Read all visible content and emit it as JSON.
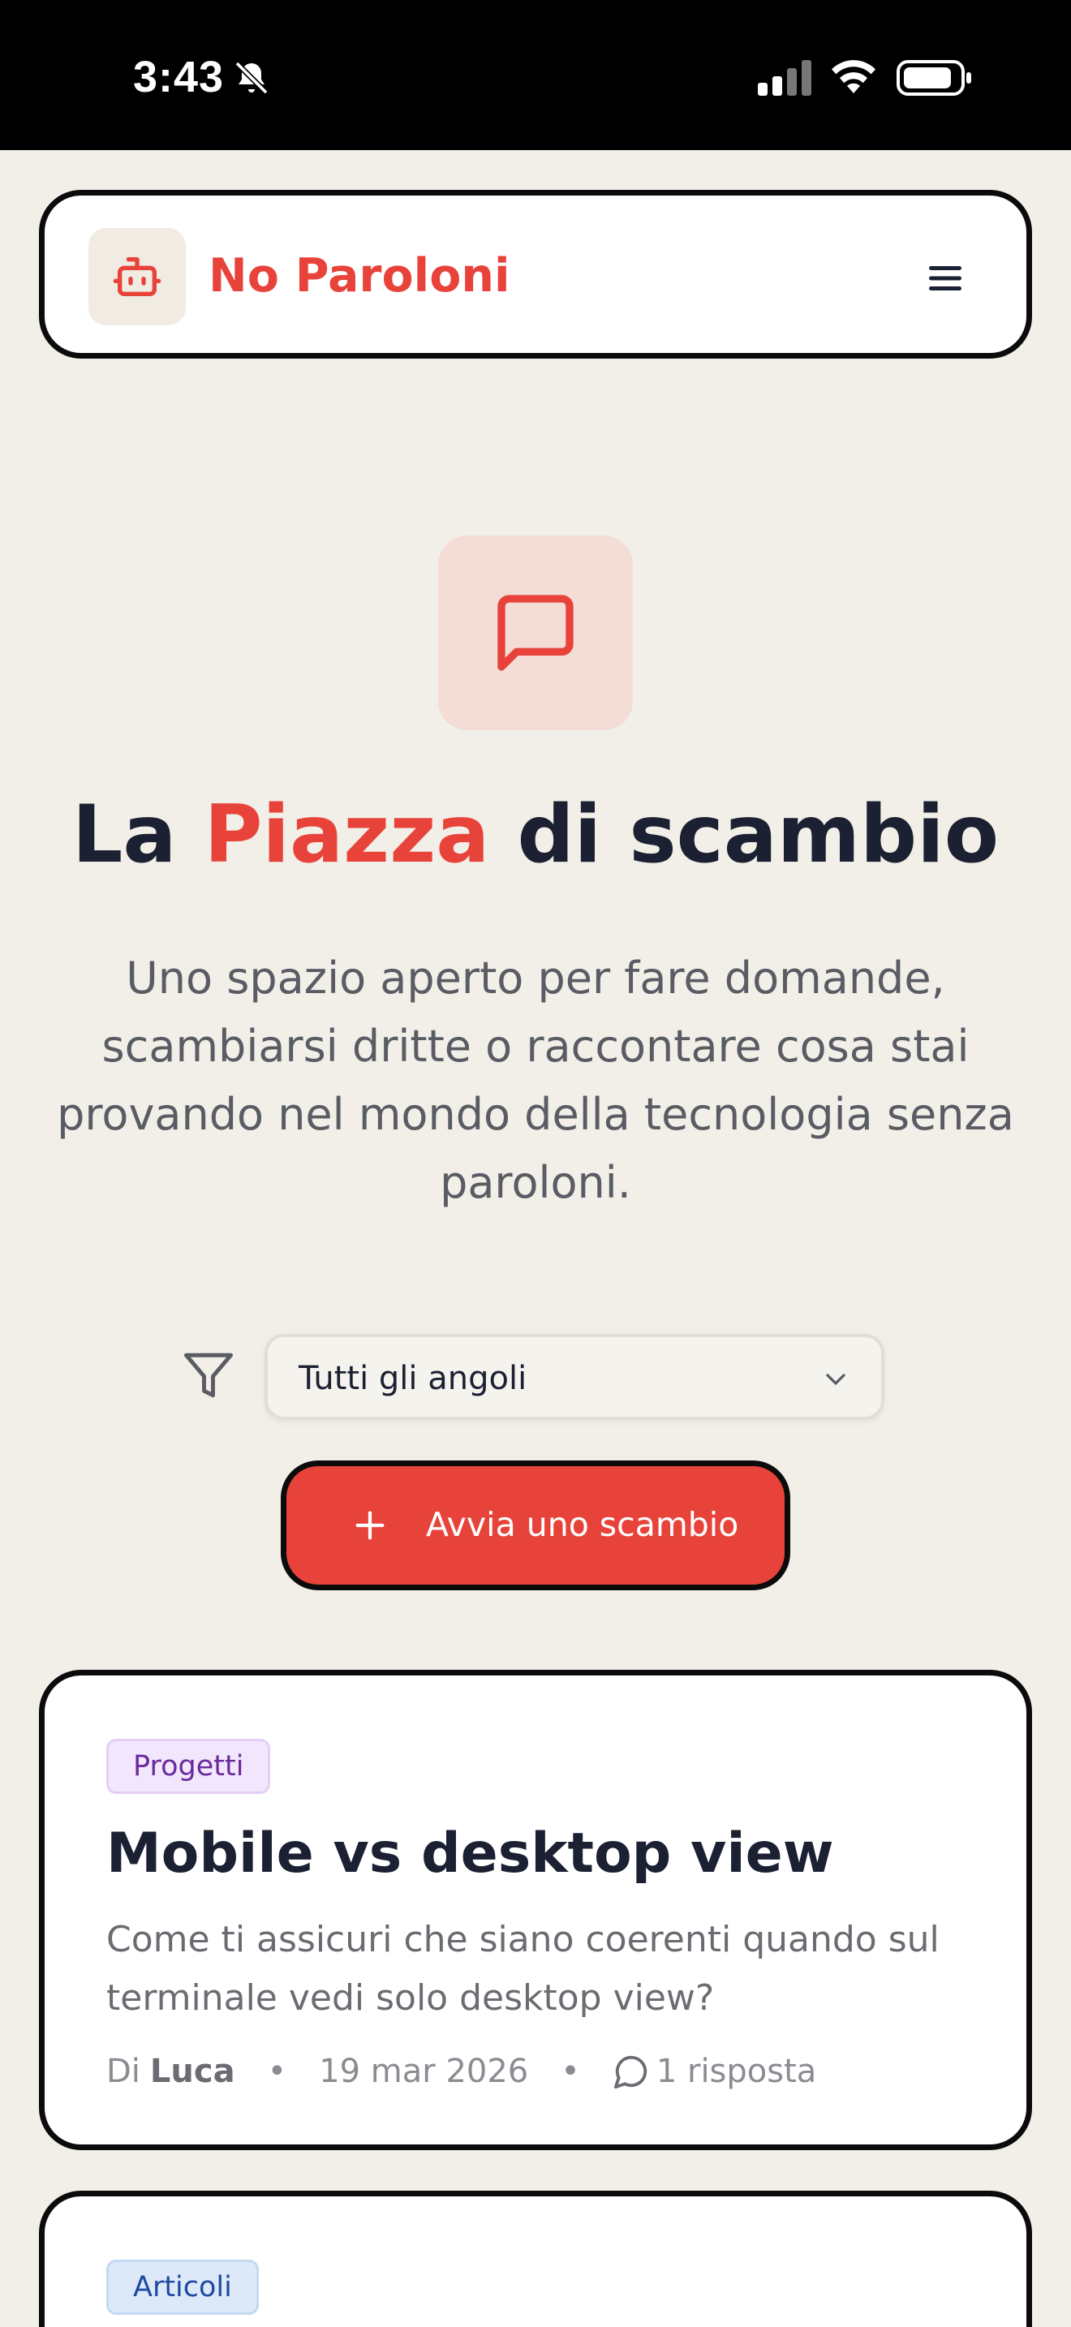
{
  "status_bar": {
    "time": "3:43"
  },
  "nav": {
    "brand": "No Paroloni"
  },
  "hero": {
    "title_part1": "La ",
    "title_accent": "Piazza",
    "title_part2": " di scambio",
    "subtitle": "Uno spazio aperto per fare domande, scambiarsi dritte o raccontare cosa stai provando nel mondo della tecnologia senza paroloni."
  },
  "filter": {
    "selected": "Tutti gli angoli"
  },
  "cta": {
    "label": "Avvia uno scambio"
  },
  "threads": [
    {
      "tag": "Progetti",
      "title": "Mobile vs desktop view",
      "description": "Come ti assicuri che siano coerenti quando sul terminale vedi solo desktop view?",
      "author_prefix": "Di",
      "author": "Luca",
      "date": "19 mar 2026",
      "replies": "1 risposta"
    },
    {
      "tag": "Articoli"
    }
  ],
  "colors": {
    "accent": "#e8433a",
    "background": "#f2efe8",
    "tag_purple": "#6a2a9d",
    "tag_blue": "#1e4aa0"
  }
}
